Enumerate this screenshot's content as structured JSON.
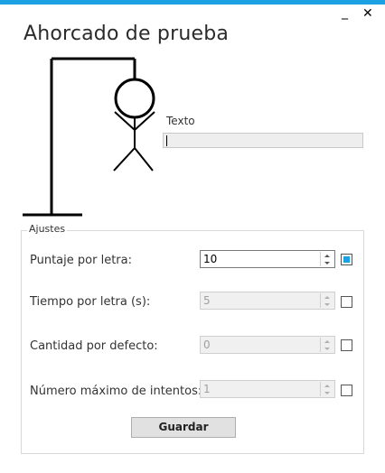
{
  "window": {
    "title": "Ahorcado de prueba",
    "minimize_glyph": "_",
    "close_glyph": "✕",
    "accent_color": "#1ba1e2"
  },
  "hangman": {
    "icon": "hangman-gallows-figure"
  },
  "texto": {
    "label": "Texto",
    "value": ""
  },
  "ajustes": {
    "legend": "Ajustes",
    "rows": [
      {
        "label": "Puntaje por letra:",
        "value": "10",
        "enabled": true,
        "checked": true
      },
      {
        "label": "Tiempo por letra (s):",
        "value": "5",
        "enabled": false,
        "checked": false
      },
      {
        "label": "Cantidad por defecto:",
        "value": "0",
        "enabled": false,
        "checked": false
      },
      {
        "label": "Número máximo de intentos:",
        "value": "1",
        "enabled": false,
        "checked": false
      }
    ],
    "save_label": "Guardar"
  }
}
